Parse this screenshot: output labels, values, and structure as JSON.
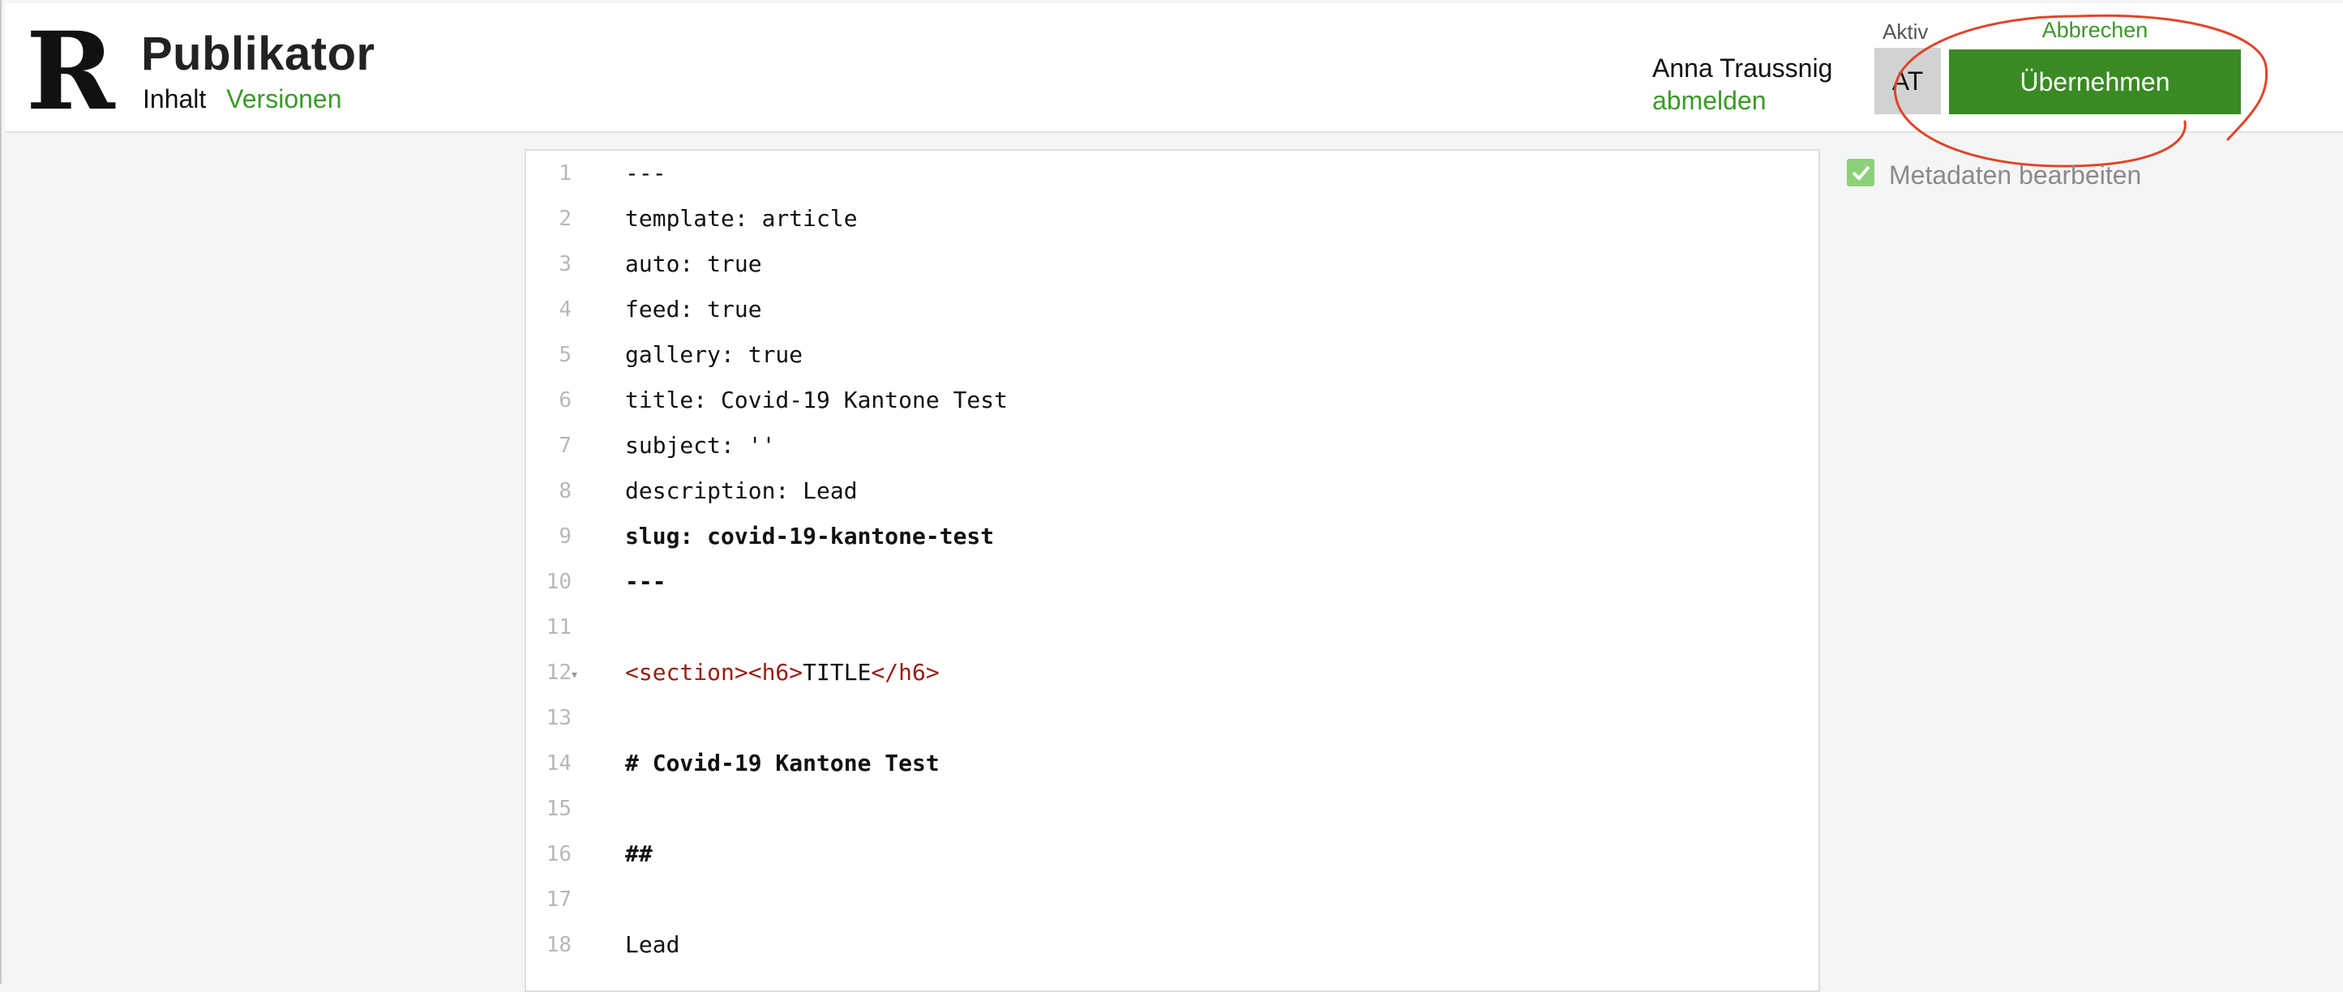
{
  "header": {
    "logo_letter": "R",
    "app_title": "Publikator",
    "nav": {
      "inhalt": "Inhalt",
      "versionen": "Versionen"
    },
    "user": {
      "name": "Anna Traussnig",
      "logout": "abmelden"
    },
    "aktiv_label": "Aktiv",
    "avatar_initials": "AT",
    "cancel_label": "Abbrechen",
    "apply_label": "Übernehmen",
    "accent_color": "#3a8a24",
    "link_color": "#3a9a27",
    "annotation_color": "#e0442a"
  },
  "sidebar": {
    "metadata_checkbox": {
      "label": "Metadaten bearbeiten",
      "checked": true
    }
  },
  "editor": {
    "lines": [
      {
        "n": "1",
        "text": "---",
        "style": "plain"
      },
      {
        "n": "2",
        "text": "template: article",
        "style": "plain"
      },
      {
        "n": "3",
        "text": "auto: true",
        "style": "plain"
      },
      {
        "n": "4",
        "text": "feed: true",
        "style": "plain"
      },
      {
        "n": "5",
        "text": "gallery: true",
        "style": "plain"
      },
      {
        "n": "6",
        "text": "title: Covid-19 Kantone Test",
        "style": "plain"
      },
      {
        "n": "7",
        "text": "subject: ''",
        "style": "plain"
      },
      {
        "n": "8",
        "text": "description: Lead",
        "style": "plain"
      },
      {
        "n": "9",
        "text": "slug: covid-19-kantone-test",
        "style": "bold"
      },
      {
        "n": "10",
        "text": "---",
        "style": "bold"
      },
      {
        "n": "11",
        "text": "",
        "style": "plain"
      },
      {
        "n": "12",
        "text": "",
        "style": "html",
        "fold": true,
        "parts": [
          {
            "t": "<section>",
            "c": "tag"
          },
          {
            "t": "<h6>",
            "c": "tag"
          },
          {
            "t": "TITLE",
            "c": "text"
          },
          {
            "t": "</h6>",
            "c": "tag"
          }
        ]
      },
      {
        "n": "13",
        "text": "",
        "style": "plain"
      },
      {
        "n": "14",
        "text": "# Covid-19 Kantone Test",
        "style": "bold"
      },
      {
        "n": "15",
        "text": "",
        "style": "plain"
      },
      {
        "n": "16",
        "text": "##",
        "style": "bold"
      },
      {
        "n": "17",
        "text": "",
        "style": "plain"
      },
      {
        "n": "18",
        "text": "Lead",
        "style": "plain"
      }
    ]
  }
}
